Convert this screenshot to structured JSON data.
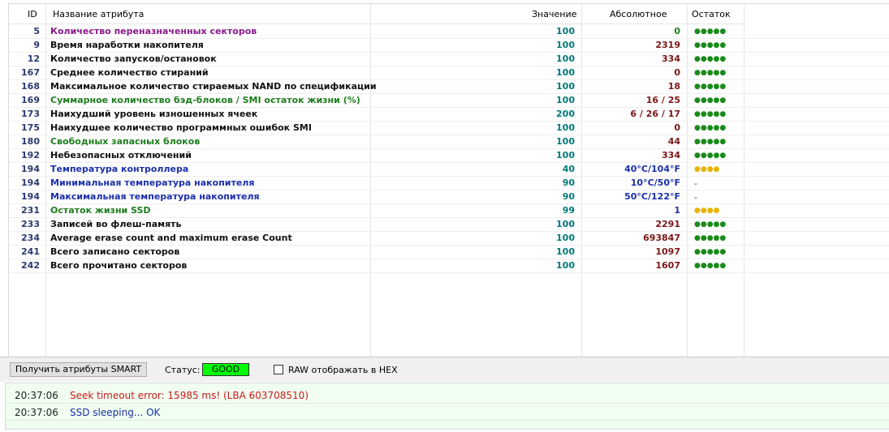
{
  "table": {
    "headers": {
      "id": "ID",
      "name": "Название атрибута",
      "value": "Значение",
      "absolute": "Абсолютное",
      "remaining": "Остаток"
    },
    "rows": [
      {
        "id": "5",
        "name": "Количество переназначенных секторов",
        "name_color": "purple",
        "value": "100",
        "absolute": "0",
        "abs_color": "green",
        "remaining": "●●●●●",
        "rem_color": "green"
      },
      {
        "id": "9",
        "name": "Время наработки накопителя",
        "name_color": "black",
        "value": "100",
        "absolute": "2319",
        "abs_color": "red",
        "remaining": "●●●●●",
        "rem_color": "green"
      },
      {
        "id": "12",
        "name": "Количество запусков/остановок",
        "name_color": "black",
        "value": "100",
        "absolute": "334",
        "abs_color": "red",
        "remaining": "●●●●●",
        "rem_color": "green"
      },
      {
        "id": "167",
        "name": "Среднее количество стираний",
        "name_color": "black",
        "value": "100",
        "absolute": "0",
        "abs_color": "red",
        "remaining": "●●●●●",
        "rem_color": "green"
      },
      {
        "id": "168",
        "name": "Максимальное количество стираемых NAND по спецификации",
        "name_color": "black",
        "value": "100",
        "absolute": "18",
        "abs_color": "red",
        "remaining": "●●●●●",
        "rem_color": "green"
      },
      {
        "id": "169",
        "name": "Суммарное количество бэд-блоков / SMI остаток жизни (%)",
        "name_color": "green",
        "value": "100",
        "absolute": "16 / 25",
        "abs_color": "red",
        "remaining": "●●●●●",
        "rem_color": "green"
      },
      {
        "id": "173",
        "name": "Наихудший уровень изношенных ячеек",
        "name_color": "black",
        "value": "200",
        "absolute": "6 / 26 / 17",
        "abs_color": "red",
        "remaining": "●●●●●",
        "rem_color": "green"
      },
      {
        "id": "175",
        "name": "Наихудшее количество программных ошибок SMI",
        "name_color": "black",
        "value": "100",
        "absolute": "0",
        "abs_color": "red",
        "remaining": "●●●●●",
        "rem_color": "green"
      },
      {
        "id": "180",
        "name": "Свободных запасных блоков",
        "name_color": "green",
        "value": "100",
        "absolute": "44",
        "abs_color": "red",
        "remaining": "●●●●●",
        "rem_color": "green"
      },
      {
        "id": "192",
        "name": "Небезопасных отключений",
        "name_color": "black",
        "value": "100",
        "absolute": "334",
        "abs_color": "red",
        "remaining": "●●●●●",
        "rem_color": "green"
      },
      {
        "id": "194",
        "name": "Температура контроллера",
        "name_color": "blue",
        "value": "40",
        "absolute": "40°C/104°F",
        "abs_color": "blue",
        "remaining": "●●●●",
        "rem_color": "yellow"
      },
      {
        "id": "194",
        "name": "Минимальная температура накопителя",
        "name_color": "blue",
        "value": "90",
        "absolute": "10°C/50°F",
        "abs_color": "blue",
        "remaining": "-",
        "rem_color": "dash"
      },
      {
        "id": "194",
        "name": "Максимальная температура накопителя",
        "name_color": "blue",
        "value": "90",
        "absolute": "50°C/122°F",
        "abs_color": "blue",
        "remaining": "-",
        "rem_color": "dash"
      },
      {
        "id": "231",
        "name": "Остаток жизни SSD",
        "name_color": "green",
        "value": "99",
        "absolute": "1",
        "abs_color": "blue",
        "remaining": "●●●●",
        "rem_color": "yellow"
      },
      {
        "id": "233",
        "name": "Записей во флеш-память",
        "name_color": "black",
        "value": "100",
        "absolute": "2291",
        "abs_color": "red",
        "remaining": "●●●●●",
        "rem_color": "green"
      },
      {
        "id": "234",
        "name": "Average erase count and maximum erase Count",
        "name_color": "black",
        "value": "100",
        "absolute": "693847",
        "abs_color": "red",
        "remaining": "●●●●●",
        "rem_color": "green"
      },
      {
        "id": "241",
        "name": "Всего записано секторов",
        "name_color": "black",
        "value": "100",
        "absolute": "1097",
        "abs_color": "red",
        "remaining": "●●●●●",
        "rem_color": "green"
      },
      {
        "id": "242",
        "name": "Всего прочитано секторов",
        "name_color": "black",
        "value": "100",
        "absolute": "1607",
        "abs_color": "red",
        "remaining": "●●●●●",
        "rem_color": "green"
      }
    ]
  },
  "toolbar": {
    "get_smart_label": "Получить атрибуты SMART",
    "status_label": "Статус:",
    "status_value": "GOOD",
    "status_color": "#00ff00",
    "hex_label": "RAW отображать в HEX",
    "hex_checked": false
  },
  "log": [
    {
      "time": "20:37:06",
      "message": "Seek timeout error: 15985 ms! (LBA 603708510)",
      "color": "red"
    },
    {
      "time": "20:37:06",
      "message": "SSD sleeping... OK",
      "color": "blue"
    }
  ]
}
